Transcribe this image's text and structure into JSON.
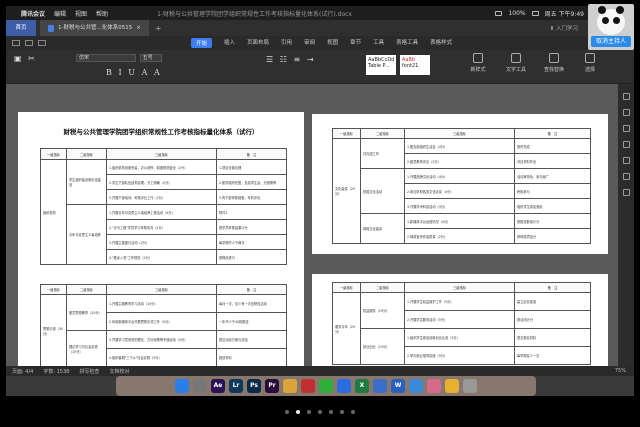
{
  "menubar": {
    "app_name": "腾讯会议",
    "menus": [
      "编辑",
      "视图",
      "帮助"
    ],
    "window_title": "1-财税与公共管理学院团学组织常规性工作考核指标量化体系(试行).docx",
    "battery": "100%",
    "clock": "周五 下午9:49"
  },
  "presenter": {
    "button_label": "取消主持人"
  },
  "tabs": {
    "home": "首页",
    "doc_tab": "1-财税与公共管...化体系0515",
    "sync": "⬇ 入门学习"
  },
  "ribbon_menu": {
    "items": [
      "开始",
      "插入",
      "页面布局",
      "引用",
      "审阅",
      "视图",
      "章节",
      "工具",
      "表格工具",
      "表格样式"
    ],
    "active": "开始"
  },
  "ribbon": {
    "font_name": "仿宋",
    "font_size": "五号",
    "styles": [
      "AaBbCcDd",
      "AaBb",
      "Aa"
    ],
    "style_names": [
      "Table P...",
      "font21"
    ],
    "tools": [
      "新样式",
      "文字工具",
      "查找替换",
      "选择"
    ]
  },
  "doc": {
    "page1_title": "财税与公共管理学院团学组织常规性工作考核指标量化体系（试行）",
    "headers": [
      "一级指标",
      "二级指标",
      "三级指标",
      "备　注"
    ],
    "p1_rows": [
      {
        "a": "组织机构",
        "b": "学生组织建设和队伍建设",
        "c": "1.组织机构设置完善，办公场所、制度规范健全（2分）",
        "d": "1.项目设置合理"
      },
      {
        "a": "",
        "b": "",
        "c": "2.学生干部队伍结构合理，分工明确（2分）",
        "d": "2.团学组织完整，包括学生会、分团委等"
      },
      {
        "a": "",
        "b": "",
        "c": "3.开展干部培训、考核评比工作（2分）",
        "d": "3.有干部考核制度，年终评优"
      },
      {
        "a": "",
        "b": "青年马克思主义者培养",
        "c": "1.开展青年马克思主义者培养工程活动（4分）",
        "d": "附件1"
      },
      {
        "a": "",
        "b": "",
        "c": "2.\"青马工程\"学员学习考核情况（2分）",
        "d": "按学员考核结果计分"
      },
      {
        "a": "",
        "b": "",
        "c": "3.开展主题团日活动（2分）",
        "d": "每学期不少于两次"
      },
      {
        "a": "",
        "b": "",
        "c": "4.\"推优入党\"工作规范（2分）",
        "d": "按程序进行"
      }
    ],
    "p2_rows": [
      {
        "a": "思想引领（30分）",
        "b": "团员思想教育（20分）",
        "c": "1.开展主题教育学习活动（10分）",
        "d": "每月一次，至少有一次全院性活动"
      },
      {
        "a": "",
        "b": "",
        "c": "2.利用新媒体平台开展思想引领工作（5分）",
        "d": "一年不少于40篇推送"
      },
      {
        "a": "",
        "b": "理论学习与社会实践（10分）",
        "c": "3.开展学习贯彻党的理论、方针政策等专题活动（5分）",
        "d": "提交活动方案与总结"
      },
      {
        "a": "",
        "b": "",
        "c": "4.组织暑期\"三下乡\"社会实践（5分）",
        "d": "报送材料"
      }
    ],
    "p3_rows": [
      {
        "a": "",
        "b": "共青团工作",
        "c": "1.团支部组织生活会（4分）",
        "d": "按时完成"
      },
      {
        "a": "",
        "b": "",
        "c": "2.团员教育评议（2分）",
        "d": "评议材料齐全"
      },
      {
        "a": "文化建设（20分）",
        "b": "校园文化活动",
        "c": "1.开展品牌文化活动（4分）",
        "d": "活动有特色，参与面广"
      },
      {
        "a": "",
        "b": "",
        "c": "2.参加学校各类文化活动（4分）",
        "d": "积极参与"
      },
      {
        "a": "",
        "b": "",
        "c": "3.开展学术科技活动（4分）",
        "d": "组织学生参加竞赛"
      },
      {
        "a": "",
        "b": "网络文化建设",
        "c": "1.新媒体平台运营情况（4分）",
        "d": "按推送数量计分"
      },
      {
        "a": "",
        "b": "",
        "c": "2.网络宣传作品质量（2分）",
        "d": "获得奖项加分"
      }
    ],
    "p4_rows": [
      {
        "a": "服务青年（20分）",
        "b": "权益服务（10分）",
        "c": "1.开展学生权益维护工作（5分）",
        "d": "建立反馈渠道"
      },
      {
        "a": "",
        "b": "",
        "c": "2.开展学生服务活动（5分）",
        "d": "按活动计分"
      },
      {
        "a": "",
        "b": "就业创业（10分）",
        "c": "1.组织学生参加创新创业比赛（5分）",
        "d": "提交报名材料"
      },
      {
        "a": "",
        "b": "",
        "c": "2.举办就业指导讲座（5分）",
        "d": "每学期至少一次"
      }
    ]
  },
  "statusbar": {
    "page": "页面: 4/4",
    "words": "字数: 1538",
    "spell": "拼写检查",
    "compat": "文档校对",
    "zoom": "75%"
  },
  "dock_apps": [
    {
      "name": "finder",
      "label": "",
      "color": "#2b7de9"
    },
    {
      "name": "launchpad",
      "label": "",
      "color": "#777777"
    },
    {
      "name": "after-effects",
      "label": "Ae",
      "color": "#2b1456"
    },
    {
      "name": "lightroom",
      "label": "Lr",
      "color": "#0d3a5a"
    },
    {
      "name": "photoshop",
      "label": "Ps",
      "color": "#0a2a4a"
    },
    {
      "name": "premiere",
      "label": "Pr",
      "color": "#2b0b3a"
    },
    {
      "name": "chrome",
      "label": "",
      "color": "#d9a53a"
    },
    {
      "name": "qq",
      "label": "",
      "color": "#c03030"
    },
    {
      "name": "wechat",
      "label": "",
      "color": "#2fae3a"
    },
    {
      "name": "meeting",
      "label": "",
      "color": "#2a6ee0"
    },
    {
      "name": "excel",
      "label": "X",
      "color": "#1e7a3e"
    },
    {
      "name": "word",
      "label": "",
      "color": "#3a6ec8"
    },
    {
      "name": "wps",
      "label": "W",
      "color": "#2a5fc0"
    },
    {
      "name": "thunder",
      "label": "",
      "color": "#3a8ad8"
    },
    {
      "name": "photos",
      "label": "",
      "color": "#d56a8a"
    },
    {
      "name": "qqmusic",
      "label": "",
      "color": "#e8b030"
    },
    {
      "name": "trash",
      "label": "",
      "color": "#999999"
    }
  ]
}
